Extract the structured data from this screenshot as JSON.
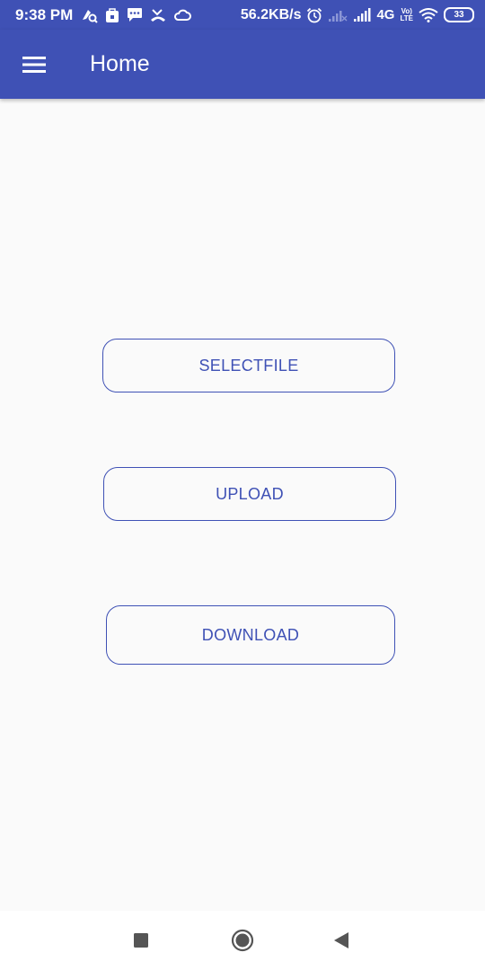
{
  "status_bar": {
    "time": "9:38 PM",
    "net_speed": "56.2KB/s",
    "network_type": "4G",
    "network_sub": "ıı",
    "volte_top": "Vo)",
    "volte_bottom": "LTE",
    "battery_level": "33",
    "icons": [
      "notification-icon",
      "bag-icon",
      "message-icon",
      "missed-call-icon",
      "cloud-icon",
      "alarm-icon",
      "signal-weak-icon",
      "signal-icon",
      "volte-icon",
      "wifi-icon",
      "battery-icon"
    ]
  },
  "app_bar": {
    "title": "Home",
    "menu_icon": "hamburger-menu-icon",
    "color": "#3f51b5"
  },
  "main": {
    "buttons": [
      {
        "label": "SELECTFILE"
      },
      {
        "label": "UPLOAD"
      },
      {
        "label": "DOWNLOAD"
      }
    ],
    "accent_color": "#3f51b5",
    "background_color": "#fafafa"
  },
  "nav_bar": {
    "items": [
      {
        "icon": "recents-square-icon"
      },
      {
        "icon": "home-circle-icon"
      },
      {
        "icon": "back-triangle-icon"
      }
    ]
  }
}
